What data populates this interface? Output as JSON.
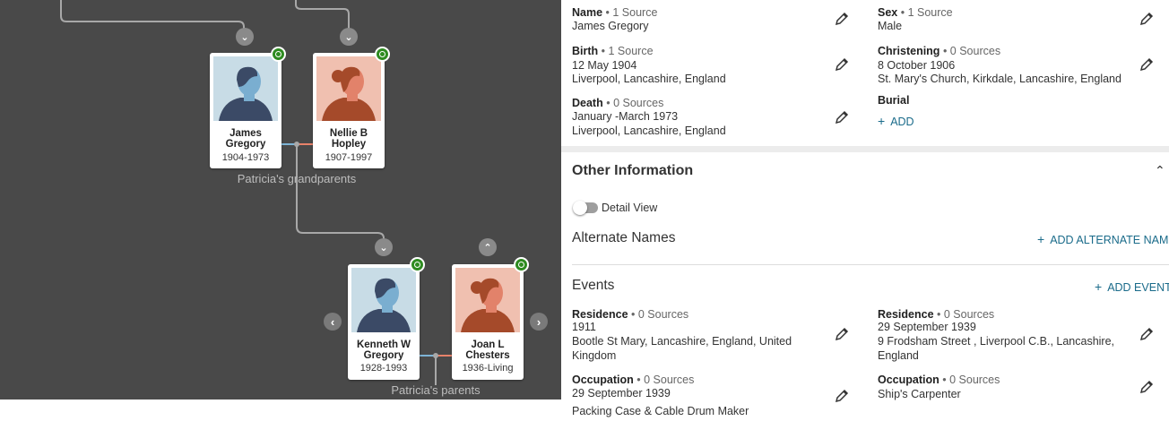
{
  "tree": {
    "grandparents": {
      "label": "Patricia's grandparents",
      "father": {
        "name_line1": "James",
        "name_line2": "Gregory",
        "years": "1904-1973"
      },
      "mother": {
        "name_line1": "Nellie B",
        "name_line2": "Hopley",
        "years": "1907-1997"
      }
    },
    "parents": {
      "label": "Patricia's parents",
      "father": {
        "name_line1": "Kenneth W",
        "name_line2": "Gregory",
        "years": "1928-1993"
      },
      "mother": {
        "name_line1": "Joan L",
        "name_line2": "Chesters",
        "years": "1936-Living"
      }
    },
    "colors": {
      "background": "#494949",
      "male": "#c8dce6",
      "female": "#f0c0b0",
      "leaf": "#2e8b20",
      "line": "#a8a8a8"
    }
  },
  "facts": {
    "name": {
      "label": "Name",
      "sources": "• 1 Source",
      "value": "James Gregory"
    },
    "sex": {
      "label": "Sex",
      "sources": "• 1 Source",
      "value": "Male"
    },
    "birth": {
      "label": "Birth",
      "sources": "• 1 Source",
      "date": "12 May 1904",
      "place": "Liverpool, Lancashire, England"
    },
    "christening": {
      "label": "Christening",
      "sources": "• 0 Sources",
      "date": "8 October 1906",
      "place": "St. Mary's Church, Kirkdale, Lancashire, England"
    },
    "death": {
      "label": "Death",
      "sources": "• 0 Sources",
      "date": "January -March 1973",
      "place": "Liverpool, Lancashire, England"
    },
    "burial": {
      "label": "Burial",
      "add_label": "ADD"
    }
  },
  "other_information": {
    "title": "Other Information",
    "detail_view_label": "Detail View",
    "alternate_names": {
      "title": "Alternate Names",
      "add_label": "ADD ALTERNATE NAME"
    },
    "events": {
      "title": "Events",
      "add_label": "ADD EVENT",
      "items": [
        {
          "label": "Residence",
          "sources": "• 0 Sources",
          "date": "1911",
          "place": "Bootle St Mary, Lancashire, England, United Kingdom"
        },
        {
          "label": "Residence",
          "sources": "• 0 Sources",
          "date": "29 September 1939",
          "place": "9 Frodsham Street , Liverpool C.B., Lancashire, England"
        },
        {
          "label": "Occupation",
          "sources": "• 0 Sources",
          "date": "29 September 1939",
          "place": "Packing Case & Cable Drum Maker"
        },
        {
          "label": "Occupation",
          "sources": "• 0 Sources",
          "date": "Ship's Carpenter",
          "place": ""
        }
      ]
    }
  },
  "accent_color": "#1a6b8a"
}
